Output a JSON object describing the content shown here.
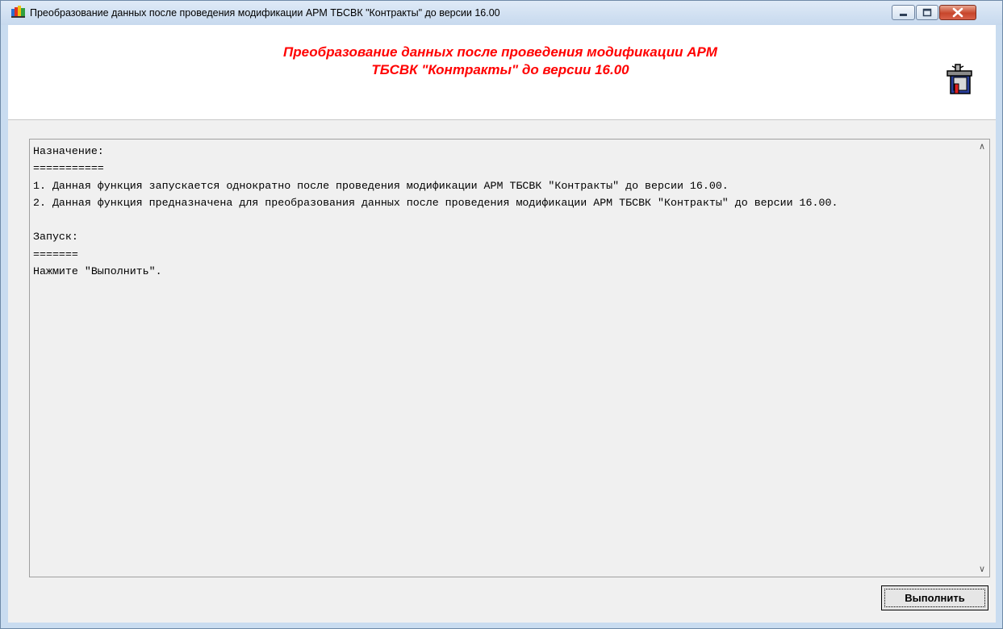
{
  "window": {
    "title": "Преобразование данных после проведения модификации АРМ ТБСВК \"Контракты\" до версии 16.00",
    "controls": {
      "minimize": "minimize",
      "maximize": "maximize",
      "close": "close"
    }
  },
  "header": {
    "title_line1": "Преобразование данных после проведения модификации АРМ",
    "title_line2": "ТБСВК \"Контракты\" до версии 16.00",
    "title_color": "#ff0000",
    "icon": "tools-box-icon"
  },
  "memo": {
    "text": "Назначение:\n===========\n1. Данная функция запускается однократно после проведения модификации АРМ ТБСВК \"Контракты\" до версии 16.00.\n2. Данная функция предназначена для преобразования данных после проведения модификации АРМ ТБСВК \"Контракты\" до версии 16.00.\n\nЗапуск:\n=======\nНажмите \"Выполнить\"."
  },
  "buttons": {
    "run": "Выполнить"
  }
}
